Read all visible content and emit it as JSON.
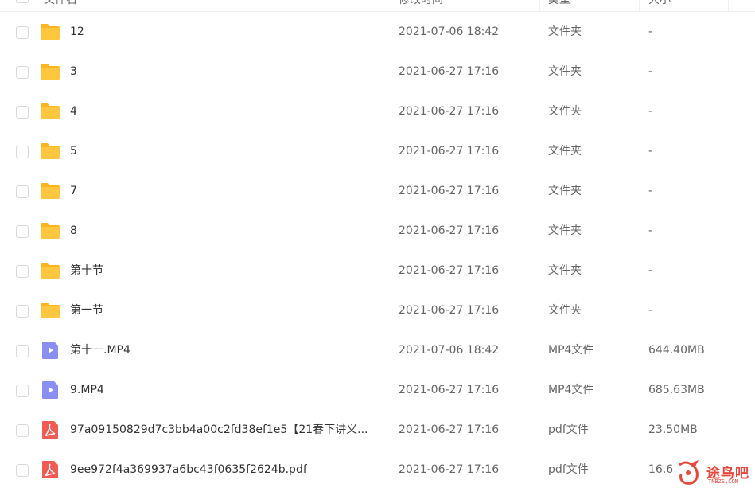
{
  "header": {
    "name": "文件名",
    "modified": "修改时间",
    "type": "类型",
    "size": "大小"
  },
  "files": [
    {
      "name": "12",
      "time": "2021-07-06 18:42",
      "type": "文件夹",
      "size": "-",
      "icon": "folder-icon"
    },
    {
      "name": "3",
      "time": "2021-06-27 17:16",
      "type": "文件夹",
      "size": "-",
      "icon": "folder-icon"
    },
    {
      "name": "4",
      "time": "2021-06-27 17:16",
      "type": "文件夹",
      "size": "-",
      "icon": "folder-icon"
    },
    {
      "name": "5",
      "time": "2021-06-27 17:16",
      "type": "文件夹",
      "size": "-",
      "icon": "folder-icon"
    },
    {
      "name": "7",
      "time": "2021-06-27 17:16",
      "type": "文件夹",
      "size": "-",
      "icon": "folder-icon"
    },
    {
      "name": "8",
      "time": "2021-06-27 17:16",
      "type": "文件夹",
      "size": "-",
      "icon": "folder-icon"
    },
    {
      "name": "第十节",
      "time": "2021-06-27 17:16",
      "type": "文件夹",
      "size": "-",
      "icon": "folder-icon"
    },
    {
      "name": "第一节",
      "time": "2021-06-27 17:16",
      "type": "文件夹",
      "size": "-",
      "icon": "folder-icon"
    },
    {
      "name": "第十一.MP4",
      "time": "2021-07-06 18:42",
      "type": "MP4文件",
      "size": "644.40MB",
      "icon": "video-file-icon"
    },
    {
      "name": "9.MP4",
      "time": "2021-06-27 17:16",
      "type": "MP4文件",
      "size": "685.63MB",
      "icon": "video-file-icon"
    },
    {
      "name": "97a09150829d7c3bb4a00c2fd38ef1e5【21春下讲义...",
      "time": "2021-06-27 17:16",
      "type": "pdf文件",
      "size": "23.50MB",
      "icon": "pdf-file-icon"
    },
    {
      "name": "9ee972f4a369937a6bc43f0635f2624b.pdf",
      "time": "2021-06-27 17:16",
      "type": "pdf文件",
      "size": "16.6",
      "icon": "pdf-file-icon"
    }
  ],
  "watermark": {
    "text": "途鸟吧",
    "sub": "TNBZS.COM"
  },
  "colors": {
    "folder": "#ffc740",
    "folder_tab": "#ffb521",
    "video": "#8a8ff5",
    "pdf": "#f25a54",
    "sort_accent": "#09aaff"
  }
}
